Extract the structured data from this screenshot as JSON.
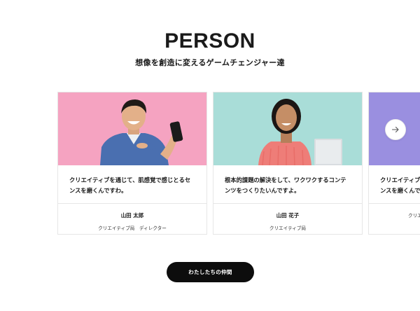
{
  "section": {
    "title": "PERSON",
    "subtitle": "想像を創造に変えるゲームチェンジャー達"
  },
  "cards": [
    {
      "quote_line1": "クリエイティブを通じて、肌感覚で感じとるセ",
      "quote_line2": "ンスを磨くんですわ。",
      "name": "山田 太郎",
      "role": "クリエイティブ局　ディレクター",
      "bg_color": "#f5a3c1"
    },
    {
      "quote_line1": "根本的課題の解決をして、ワクワクするコンテ",
      "quote_line2": "ンツをつくりたいんですよ。",
      "name": "山田 花子",
      "role": "クリエイティブ局",
      "bg_color": "#a9ddd8"
    },
    {
      "quote_line1": "クリエイティブを通じて、肌感覚で感じとるセ",
      "quote_line2": "ンスを磨くんですわ。",
      "name": "",
      "role": "クリエイティブ局",
      "bg_color": "#9a8fe0"
    }
  ],
  "carousel": {
    "next_icon": "arrow-right-icon"
  },
  "cta": {
    "label": "わたしたちの仲間"
  }
}
